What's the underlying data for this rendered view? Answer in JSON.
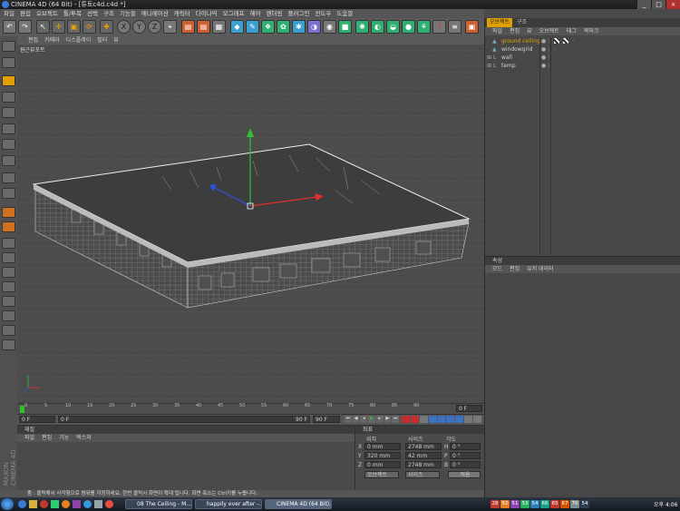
{
  "window": {
    "title": "CINEMA 4D (64 Bit) - [튜토c4d.c4d *]"
  },
  "menu": [
    "파일",
    "편집",
    "오브젝트",
    "툴/투복",
    "선택",
    "구조",
    "기능들",
    "애니메이션",
    "캐릭터",
    "다이나믹",
    "모그래프",
    "헤어",
    "렌더링",
    "플러그인",
    "윈도우",
    "도움말"
  ],
  "toolbar": {
    "axis_x": "X",
    "axis_y": "Y",
    "axis_z": "Z"
  },
  "viewport": {
    "menu": [
      "편집",
      "카메라",
      "디스플레이",
      "필터",
      "뷰"
    ],
    "label": "원근뷰포트"
  },
  "timeline": {
    "ticks": [
      "0",
      "5",
      "10",
      "15",
      "20",
      "25",
      "30",
      "35",
      "40",
      "45",
      "50",
      "55",
      "60",
      "65",
      "70",
      "75",
      "80",
      "85",
      "90"
    ],
    "end_frame": "0 F"
  },
  "playbar": {
    "current": "0 F",
    "start": "0 F",
    "end": "90 F",
    "max": "90 F"
  },
  "materials": {
    "title": "재질",
    "menu": [
      "파일",
      "편집",
      "기능",
      "텍스쳐"
    ]
  },
  "coordinates": {
    "title": "좌표",
    "headers": {
      "position": "위치",
      "size": "사이즈",
      "rotation": "각도"
    },
    "rows": [
      {
        "axis": "X",
        "pos": "0 mm",
        "size": "2748 mm",
        "rot_label": "H",
        "rot": "0 °"
      },
      {
        "axis": "Y",
        "pos": "320 mm",
        "size": "42 mm",
        "rot_label": "P",
        "rot": "0 °"
      },
      {
        "axis": "Z",
        "pos": "0 mm",
        "size": "2748 mm",
        "rot_label": "B",
        "rot": "0 °"
      }
    ],
    "dropdown_object": "오브젝트",
    "dropdown_size": "사이즈",
    "apply": "적용"
  },
  "status": {
    "text": "줌 : 클릭해서 사각형으로 범위를 지정하세요. 한번 클릭시 화면이 확대 됩니다. 화면 축소는 Ctrl키를 누릅니다."
  },
  "objects_panel": {
    "tabs": [
      "오브젝트",
      "구조"
    ],
    "menu": [
      "파일",
      "편집",
      "뷰",
      "오브젝트",
      "태그",
      "북마크"
    ],
    "items": [
      {
        "name": "ground ceiling",
        "selected": true
      },
      {
        "name": "windowgrid",
        "selected": false
      },
      {
        "name": "wall",
        "selected": false
      },
      {
        "name": "temp",
        "selected": false
      }
    ]
  },
  "attributes_panel": {
    "title": "속성",
    "menu": [
      "모드",
      "편집",
      "유저 데이터"
    ]
  },
  "taskbar": {
    "tasks": [
      "08 The Ceiling - M...",
      "happily ever after -...",
      "CINEMA 4D (64 Bit)..."
    ],
    "tray_numbers": [
      "28",
      "52",
      "51",
      "53",
      "54",
      "66",
      "65",
      "67",
      "70",
      "54"
    ],
    "tray_colors": [
      "#c0392b",
      "#e67e22",
      "#8e44ad",
      "#27ae60",
      "#2980b9",
      "#16a085",
      "#c0392b",
      "#d35400",
      "#7f8c8d",
      "#2c3e50"
    ],
    "clock": "오후 4:06"
  },
  "colors": {
    "accent": "#e0a000",
    "axis_x": "#e03030",
    "axis_y": "#30c030",
    "axis_z": "#3050e0"
  }
}
